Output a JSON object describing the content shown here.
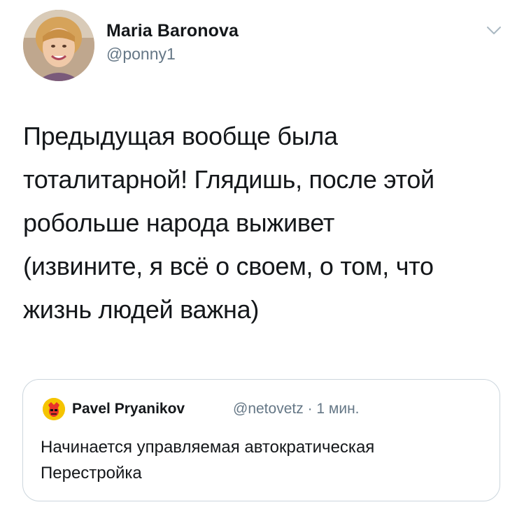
{
  "tweet": {
    "author": {
      "name": "Maria Baronova",
      "handle": "@ponny1",
      "avatar_icon": "user-avatar-photo"
    },
    "menu_icon": "chevron-down-icon",
    "text": "Предыдущая вообще была\nтоталитарной! Глядишь, после этой\npобольше народа выживет\n(извините, я всё о своем, о том, что\nжизнь людей важна)",
    "quoted_tweet": {
      "author_name": "Pavel Pryanikov",
      "author_handle": "@netovetz",
      "separator": "·",
      "time": "1 мин.",
      "avatar_icon": "quoted-user-avatar",
      "text": "Начинается управляемая автократическая\nПерестройка"
    }
  },
  "colors": {
    "primary_text": "#14171a",
    "secondary_text": "#657786",
    "border": "#ccd6dd",
    "background": "#ffffff"
  }
}
